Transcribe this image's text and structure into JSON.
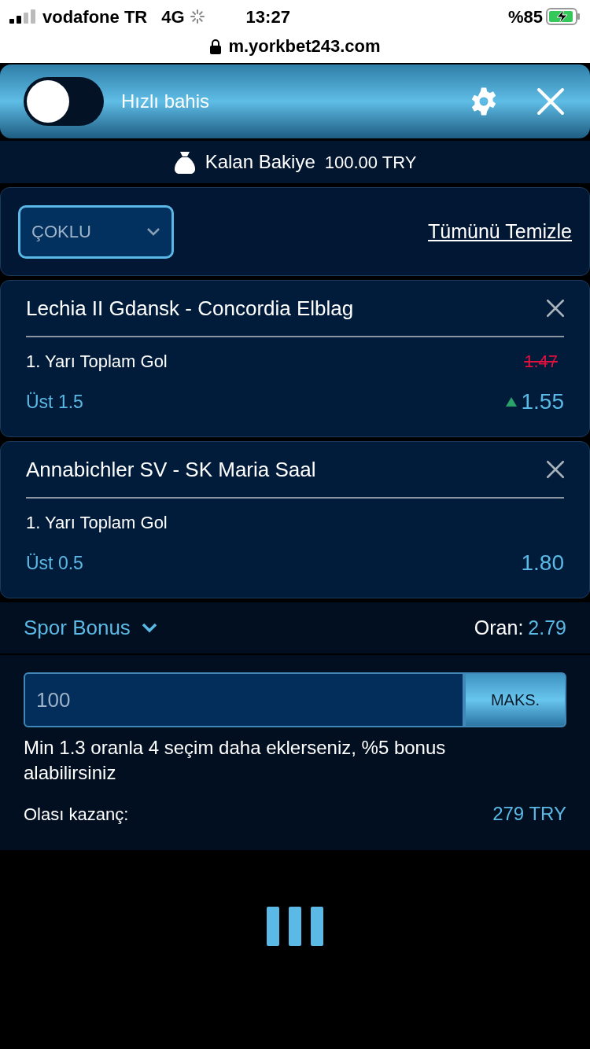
{
  "status_bar": {
    "carrier": "vodafone TR",
    "network": "4G",
    "time": "13:27",
    "battery": "%85"
  },
  "url_bar": {
    "address": "m.yorkbet243.com"
  },
  "header": {
    "quick_bet": {
      "label": "Hızlı bahis",
      "on": false
    }
  },
  "balance": {
    "label": "Kalan Bakiye",
    "amount": "100.00 TRY"
  },
  "filter": {
    "mode": "ÇOKLU",
    "clear_all": "Tümünü Temizle"
  },
  "bets": [
    {
      "match": "Lechia II Gdansk - Concordia Elblag",
      "market": "1. Yarı Toplam Gol",
      "selection": "Üst 1.5",
      "old_odds": "1.47",
      "odds_up": true,
      "odds": "1.55"
    },
    {
      "match": "Annabichler SV - SK Maria Saal",
      "market": "1. Yarı Toplam Gol",
      "selection": "Üst 0.5",
      "odds_up": false,
      "odds": "1.80"
    }
  ],
  "bonus": {
    "label": "Spor Bonus",
    "odds_label": "Oran:",
    "odds": "2.79"
  },
  "stake": {
    "value": "100",
    "max_button": "MAKS.",
    "hint": "Min 1.3 oranla 4 seçim daha eklerseniz, %5 bonus alabilirsiniz",
    "payout_label": "Olası kazanç:",
    "payout": "279 TRY"
  }
}
